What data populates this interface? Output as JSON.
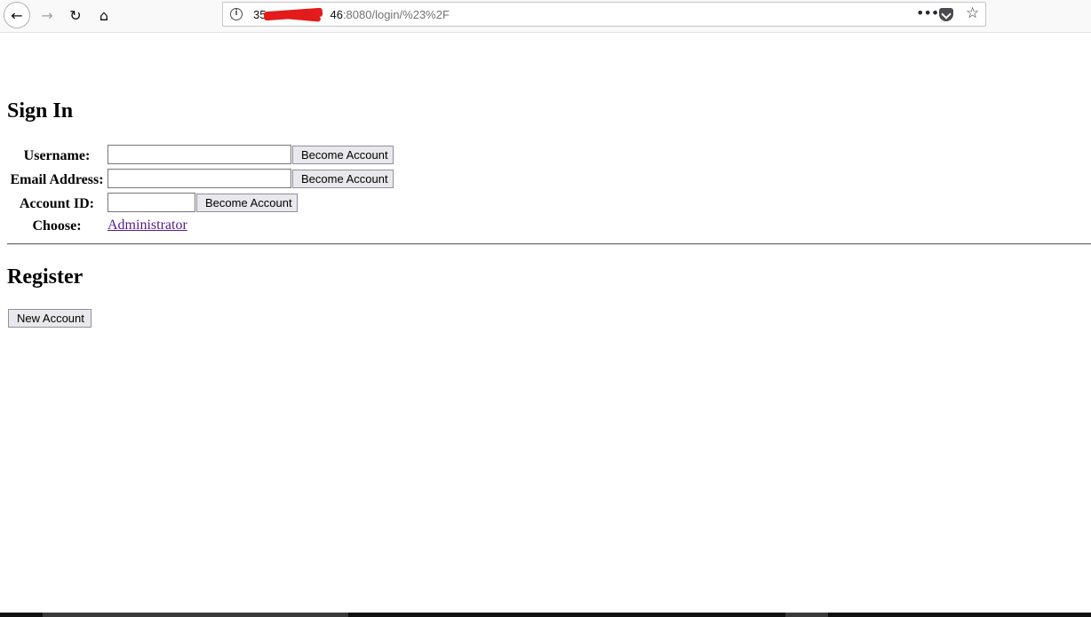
{
  "browser": {
    "url_host": "35",
    "url_host_end": "46",
    "url_path": ":8080/login/%23%2F"
  },
  "signin": {
    "title": "Sign In",
    "username_label": "Username:",
    "email_label": "Email Address:",
    "account_id_label": "Account ID:",
    "choose_label": "Choose:",
    "become_button": "Become Account",
    "choose_link": "Administrator"
  },
  "register": {
    "title": "Register",
    "new_account_button": "New Account"
  },
  "colors": {
    "link_visited": "#551a8b",
    "redaction": "#e31b1b"
  }
}
